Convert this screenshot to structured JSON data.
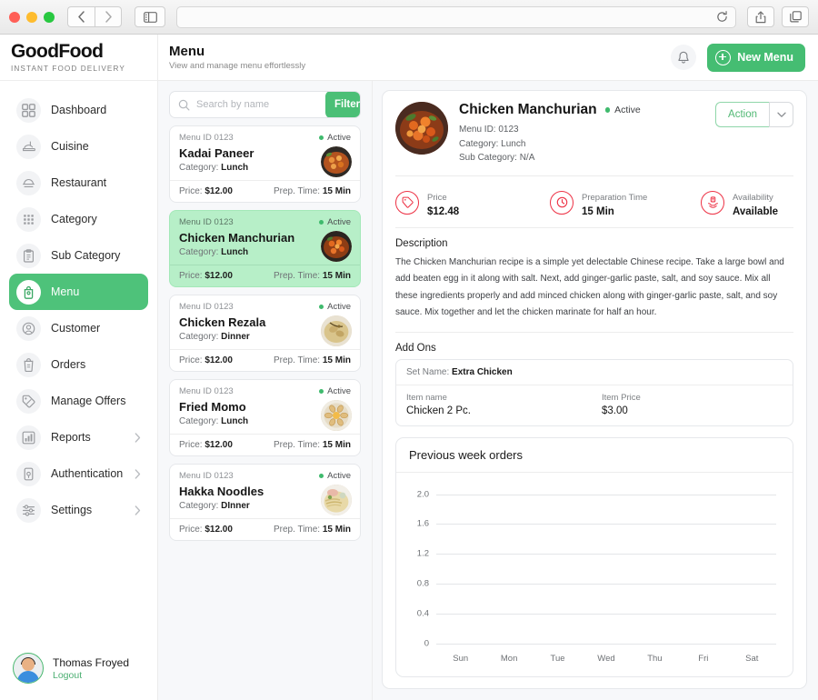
{
  "browser": {
    "back_icon": "chevron-left-icon",
    "forward_icon": "chevron-right-icon",
    "sidebar_icon": "sidebar-toggle-icon",
    "url_value": "",
    "reload_icon": "reload-icon",
    "share_icon": "share-icon",
    "tabs_icon": "tabs-icon"
  },
  "sidebar": {
    "brand": {
      "name": "GoodFood",
      "tagline": "INSTANT FOOD DELIVERY"
    },
    "items": [
      {
        "label": "Dashboard",
        "icon": "grid-icon",
        "active": false,
        "chevron": false
      },
      {
        "label": "Cuisine",
        "icon": "cuisine-icon",
        "active": false,
        "chevron": false
      },
      {
        "label": "Restaurant",
        "icon": "restaurant-icon",
        "active": false,
        "chevron": false
      },
      {
        "label": "Category",
        "icon": "category-icon",
        "active": false,
        "chevron": false
      },
      {
        "label": "Sub Category",
        "icon": "clipboard-icon",
        "active": false,
        "chevron": false
      },
      {
        "label": "Menu",
        "icon": "menu-bag-icon",
        "active": true,
        "chevron": false
      },
      {
        "label": "Customer",
        "icon": "customer-icon",
        "active": false,
        "chevron": false
      },
      {
        "label": "Orders",
        "icon": "orders-icon",
        "active": false,
        "chevron": false
      },
      {
        "label": "Manage Offers",
        "icon": "offers-tag-icon",
        "active": false,
        "chevron": false
      },
      {
        "label": "Reports",
        "icon": "reports-chart-icon",
        "active": false,
        "chevron": true
      },
      {
        "label": "Authentication",
        "icon": "authentication-icon",
        "active": false,
        "chevron": true
      },
      {
        "label": "Settings",
        "icon": "settings-sliders-icon",
        "active": false,
        "chevron": true
      }
    ],
    "user": {
      "name": "Thomas Froyed",
      "logout_label": "Logout",
      "avatar": "user-avatar"
    }
  },
  "topbar": {
    "title": "Menu",
    "subtitle": "View and manage menu effortlessly",
    "bell_icon": "notification-bell-icon",
    "new_menu_label": "New Menu"
  },
  "list": {
    "search": {
      "placeholder": "Search by name",
      "value": "",
      "icon": "search-icon"
    },
    "filter_label": "Filter",
    "filter_icon": "filter-sliders-icon",
    "price_label": "Price:",
    "prep_label": "Prep. Time:",
    "category_label": "Category:",
    "cards": [
      {
        "menu_id": "Menu ID 0123",
        "status": "Active",
        "name": "Kadai Paneer",
        "category": "Lunch",
        "price": "$12.00",
        "prep": "15 Min",
        "selected": false
      },
      {
        "menu_id": "Menu ID 0123",
        "status": "Active",
        "name": "Chicken Manchurian",
        "category": "Lunch",
        "price": "$12.00",
        "prep": "15 Min",
        "selected": true
      },
      {
        "menu_id": "Menu ID 0123",
        "status": "Active",
        "name": "Chicken Rezala",
        "category": "Dinner",
        "price": "$12.00",
        "prep": "15 Min",
        "selected": false
      },
      {
        "menu_id": "Menu ID 0123",
        "status": "Active",
        "name": "Fried Momo",
        "category": "Lunch",
        "price": "$12.00",
        "prep": "15 Min",
        "selected": false
      },
      {
        "menu_id": "Menu ID 0123",
        "status": "Active",
        "name": "Hakka Noodles",
        "category": "DInner",
        "price": "$12.00",
        "prep": "15 Min",
        "selected": false
      }
    ]
  },
  "detail": {
    "title": "Chicken Manchurian",
    "status": "Active",
    "menu_id": "Menu ID: 0123",
    "category": "Category: Lunch",
    "sub_category": "Sub Category: N/A",
    "action_label": "Action",
    "action_caret_icon": "chevron-down-icon",
    "stats": [
      {
        "label": "Price",
        "value": "$12.48",
        "icon": "price-tag-icon"
      },
      {
        "label": "Preparation Time",
        "value": "15 Min",
        "icon": "clock-icon"
      },
      {
        "label": "Availability",
        "value": "Available",
        "icon": "availability-hands-icon"
      }
    ],
    "description_title": "Description",
    "description": "The Chicken Manchurian recipe is a simple yet delectable Chinese recipe. Take a large bowl and add beaten egg in it along with salt. Next, add ginger-garlic paste, salt, and soy sauce. Mix all these ingredients properly and add minced chicken along with ginger-garlic paste, salt, and soy sauce. Mix together and let the chicken marinate for half an hour.",
    "addons_title": "Add Ons",
    "addon": {
      "set_name_label": "Set Name:",
      "set_name": "Extra Chicken",
      "item_name_header": "Item name",
      "item_price_header": "Item Price",
      "item_name": "Chicken 2 Pc.",
      "item_price": "$3.00"
    }
  },
  "chart_data": {
    "type": "bar",
    "title": "Previous week orders",
    "categories": [
      "Sun",
      "Mon",
      "Tue",
      "Wed",
      "Thu",
      "Fri",
      "Sat"
    ],
    "values": [
      0,
      0,
      0,
      0,
      0,
      0,
      0
    ],
    "yticks": [
      "2.0",
      "1.6",
      "1.2",
      "0.8",
      "0.4",
      "0"
    ],
    "ylim": [
      0,
      2.0
    ],
    "xlabel": "",
    "ylabel": "",
    "grid": true,
    "legend": "none"
  },
  "colors": {
    "brand_green": "#4bbf76",
    "selected_card": "#b7efc8",
    "status_green": "#3fba6d",
    "stat_red": "#ed3144"
  }
}
